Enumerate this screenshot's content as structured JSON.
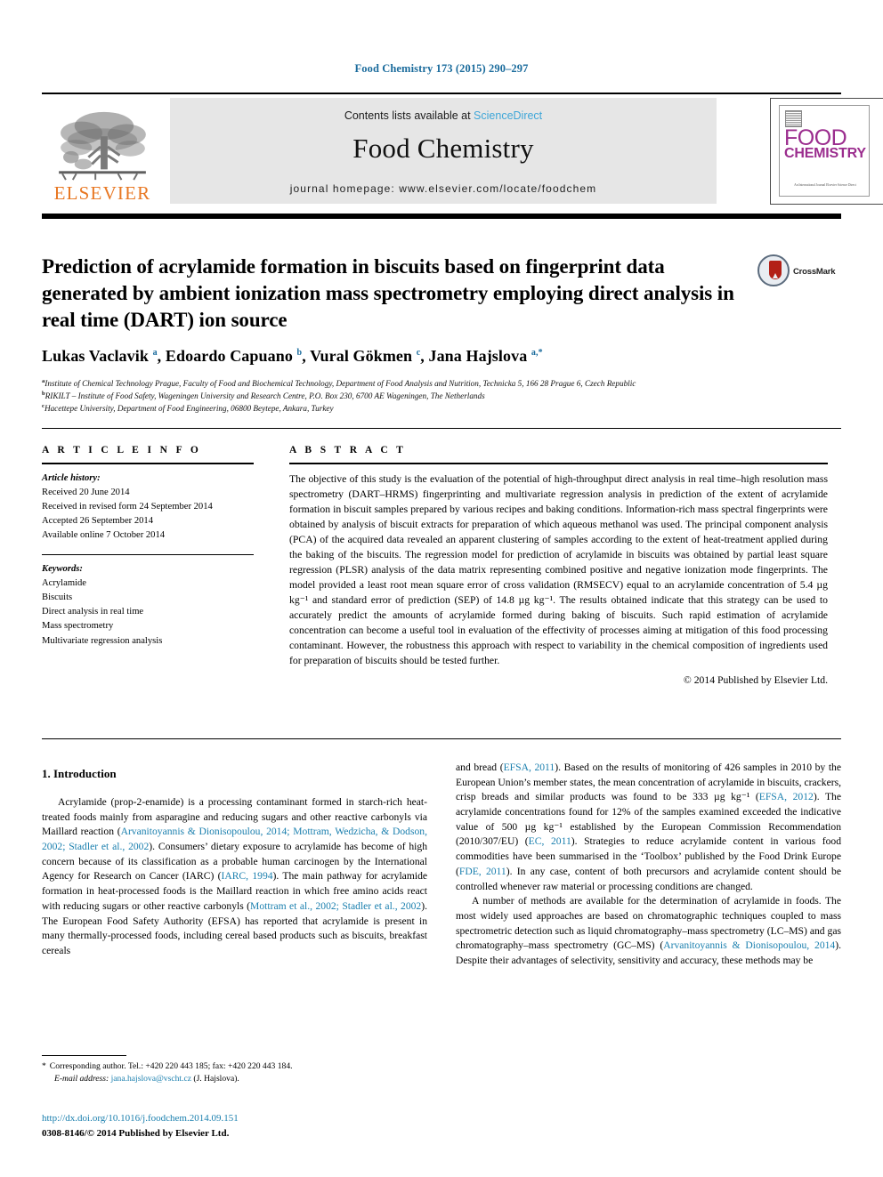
{
  "running_head": "Food Chemistry 173 (2015) 290–297",
  "masthead": {
    "contents_prefix": "Contents lists available at ",
    "sciencedirect": "ScienceDirect",
    "journal_title": "Food Chemistry",
    "homepage": "journal homepage: www.elsevier.com/locate/foodchem",
    "publisher_logo_text": "ELSEVIER",
    "cover": {
      "line1": "FOOD",
      "line2": "CHEMISTRY",
      "footer_text": "An International Journal\nElsevier Science Direct"
    },
    "accent_orange": "#E87722",
    "accent_blue": "#3ea6d8",
    "cover_magenta": "#9B2D8E"
  },
  "article": {
    "title": "Prediction of acrylamide formation in biscuits based on fingerprint data generated by ambient ionization mass spectrometry employing direct analysis in real time (DART) ion source",
    "crossmark_label": "CrossMark",
    "authors_html": "Lukas Vaclavik <sup>a</sup>, Edoardo Capuano <sup>b</sup>, Vural Gökmen <sup>c</sup>, Jana Hajslova <sup>a,*</sup>",
    "affiliations": [
      {
        "marker": "a",
        "text": "Institute of Chemical Technology Prague, Faculty of Food and Biochemical Technology, Department of Food Analysis and Nutrition, Technicka 5, 166 28 Prague 6, Czech Republic"
      },
      {
        "marker": "b",
        "text": "RIKILT – Institute of Food Safety, Wageningen University and Research Centre, P.O. Box 230, 6700 AE Wageningen, The Netherlands"
      },
      {
        "marker": "c",
        "text": "Hacettepe University, Department of Food Engineering, 06800 Beytepe, Ankara, Turkey"
      }
    ]
  },
  "article_info": {
    "heading": "A R T I C L E    I N F O",
    "history_label": "Article history:",
    "history": [
      "Received 20 June 2014",
      "Received in revised form 24 September 2014",
      "Accepted 26 September 2014",
      "Available online 7 October 2014"
    ],
    "keywords_label": "Keywords:",
    "keywords": [
      "Acrylamide",
      "Biscuits",
      "Direct analysis in real time",
      "Mass spectrometry",
      "Multivariate regression analysis"
    ]
  },
  "abstract": {
    "heading": "A B S T R A C T",
    "text": "The objective of this study is the evaluation of the potential of high-throughput direct analysis in real time–high resolution mass spectrometry (DART–HRMS) fingerprinting and multivariate regression analysis in prediction of the extent of acrylamide formation in biscuit samples prepared by various recipes and baking conditions. Information-rich mass spectral fingerprints were obtained by analysis of biscuit extracts for preparation of which aqueous methanol was used. The principal component analysis (PCA) of the acquired data revealed an apparent clustering of samples according to the extent of heat-treatment applied during the baking of the biscuits. The regression model for prediction of acrylamide in biscuits was obtained by partial least square regression (PLSR) analysis of the data matrix representing combined positive and negative ionization mode fingerprints. The model provided a least root mean square error of cross validation (RMSECV) equal to an acrylamide concentration of 5.4 µg kg⁻¹ and standard error of prediction (SEP) of 14.8 µg kg⁻¹. The results obtained indicate that this strategy can be used to accurately predict the amounts of acrylamide formed during baking of biscuits. Such rapid estimation of acrylamide concentration can become a useful tool in evaluation of the effectivity of processes aiming at mitigation of this food processing contaminant. However, the robustness this approach with respect to variability in the chemical composition of ingredients used for preparation of biscuits should be tested further.",
    "copyright": "© 2014 Published by Elsevier Ltd."
  },
  "body": {
    "section_title": "1. Introduction",
    "left_paragraphs": [
      {
        "indent": true,
        "runs": [
          {
            "t": "Acrylamide (prop-2-enamide) is a processing contaminant formed in starch-rich heat-treated foods mainly from asparagine and reducing sugars and other reactive carbonyls via Maillard reaction (",
            "link": false
          },
          {
            "t": "Arvanitoyannis & Dionisopoulou, 2014; Mottram, Wedzicha, & Dodson, 2002; Stadler et al., 2002",
            "link": true
          },
          {
            "t": "). Consumers’ dietary exposure to acrylamide has become of high concern because of its classification as a probable human carcinogen by the International Agency for Research on Cancer (IARC) (",
            "link": false
          },
          {
            "t": "IARC, 1994",
            "link": true
          },
          {
            "t": "). The main pathway for acrylamide formation in heat-processed foods is the Maillard reaction in which free amino acids react with reducing sugars or other reactive carbonyls (",
            "link": false
          },
          {
            "t": "Mottram et al., 2002; Stadler et al., 2002",
            "link": true
          },
          {
            "t": "). The European Food Safety Authority (EFSA) has reported that acrylamide is present in many thermally-processed foods, including cereal based products such as biscuits, breakfast cereals",
            "link": false
          }
        ]
      }
    ],
    "right_paragraphs": [
      {
        "indent": false,
        "runs": [
          {
            "t": "and bread (",
            "link": false
          },
          {
            "t": "EFSA, 2011",
            "link": true
          },
          {
            "t": "). Based on the results of monitoring of 426 samples in 2010 by the European Union’s member states, the mean concentration of acrylamide in biscuits, crackers, crisp breads and similar products was found to be 333 µg kg⁻¹ (",
            "link": false
          },
          {
            "t": "EFSA, 2012",
            "link": true
          },
          {
            "t": "). The acrylamide concentrations found for 12% of the samples examined exceeded the indicative value of 500 µg kg⁻¹ established by the European Commission Recommendation (2010/307/EU) (",
            "link": false
          },
          {
            "t": "EC, 2011",
            "link": true
          },
          {
            "t": "). Strategies to reduce acrylamide content in various food commodities have been summarised in the ‘Toolbox’ published by the Food Drink Europe (",
            "link": false
          },
          {
            "t": "FDE, 2011",
            "link": true
          },
          {
            "t": "). In any case, content of both precursors and acrylamide content should be controlled whenever raw material or processing conditions are changed.",
            "link": false
          }
        ]
      },
      {
        "indent": true,
        "runs": [
          {
            "t": "A number of methods are available for the determination of acrylamide in foods. The most widely used approaches are based on chromatographic techniques coupled to mass spectrometric detection such as liquid chromatography–mass spectrometry (LC–MS) and gas chromatography–mass spectrometry (GC–MS) (",
            "link": false
          },
          {
            "t": "Arvanitoyannis & Dionisopoulou, 2014",
            "link": true
          },
          {
            "t": "). Despite their advantages of selectivity, sensitivity and accuracy, these methods may be",
            "link": false
          }
        ]
      }
    ]
  },
  "footnote": {
    "star": "*",
    "corresponding": "Corresponding author. Tel.: +420 220 443 185; fax: +420 220 443 184.",
    "email_label": "E-mail address:",
    "email": "jana.hajslova@vscht.cz",
    "email_suffix": "(J. Hajslova)."
  },
  "page_footer": {
    "doi": "http://dx.doi.org/10.1016/j.foodchem.2014.09.151",
    "issn_line": "0308-8146/© 2014 Published by Elsevier Ltd."
  }
}
